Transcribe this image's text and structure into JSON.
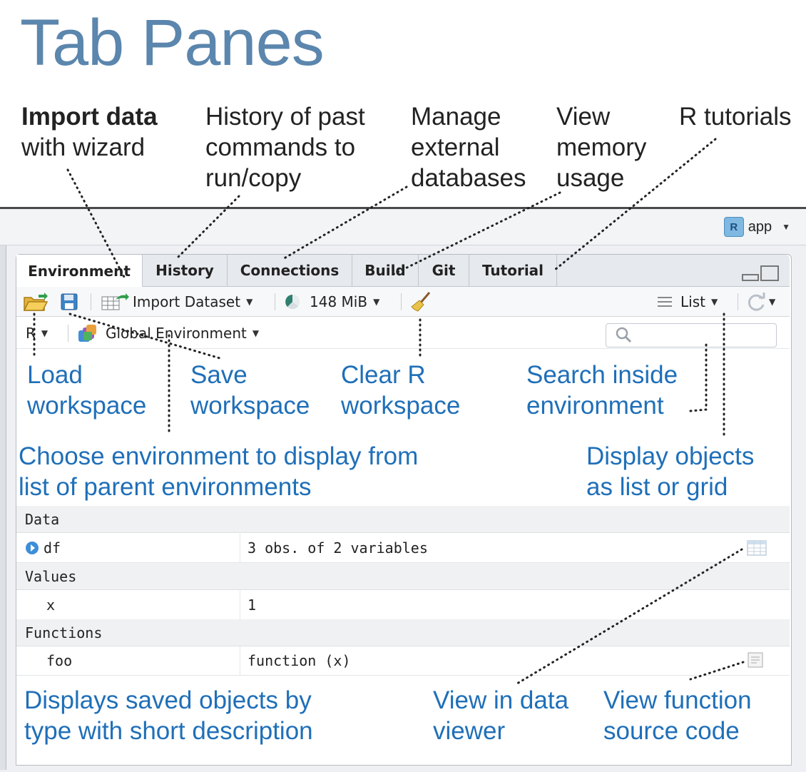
{
  "title": "Tab Panes",
  "top_notes": {
    "import_bold": "Import data",
    "import_rest": "with wizard",
    "history": [
      "History of past",
      "commands to",
      "run/copy"
    ],
    "connections": [
      "Manage",
      "external",
      "databases"
    ],
    "memory": [
      "View",
      "memory",
      "usage"
    ],
    "tutorials": "R tutorials"
  },
  "project": {
    "name": "app"
  },
  "tabs": [
    "Environment",
    "History",
    "Connections",
    "Build",
    "Git",
    "Tutorial"
  ],
  "toolbar": {
    "import_label": "Import Dataset",
    "memory_label": "148 MiB",
    "view_label": "List"
  },
  "env": {
    "language": "R",
    "environment": "Global Environment"
  },
  "mid_notes": {
    "load": [
      "Load",
      "workspace"
    ],
    "save": [
      "Save",
      "workspace"
    ],
    "clear": [
      "Clear R",
      "workspace"
    ],
    "search": [
      "Search inside",
      "environment"
    ],
    "choose": [
      "Choose environment to display from",
      "list of parent environments"
    ],
    "display": [
      "Display objects",
      "as list or grid"
    ]
  },
  "sections": {
    "data": "Data",
    "values": "Values",
    "functions": "Functions"
  },
  "rows": {
    "df": {
      "name": "df",
      "value": "3 obs. of 2 variables"
    },
    "x": {
      "name": "x",
      "value": "1"
    },
    "foo": {
      "name": "foo",
      "value": "function (x)"
    }
  },
  "bottom_notes": {
    "displays": [
      "Displays saved objects by",
      "type with short description"
    ],
    "viewer": [
      "View in data",
      "viewer"
    ],
    "source": [
      "View function",
      "source code"
    ]
  },
  "colors": {
    "title": "#5b86ad",
    "annotation": "#1f6fb8"
  }
}
